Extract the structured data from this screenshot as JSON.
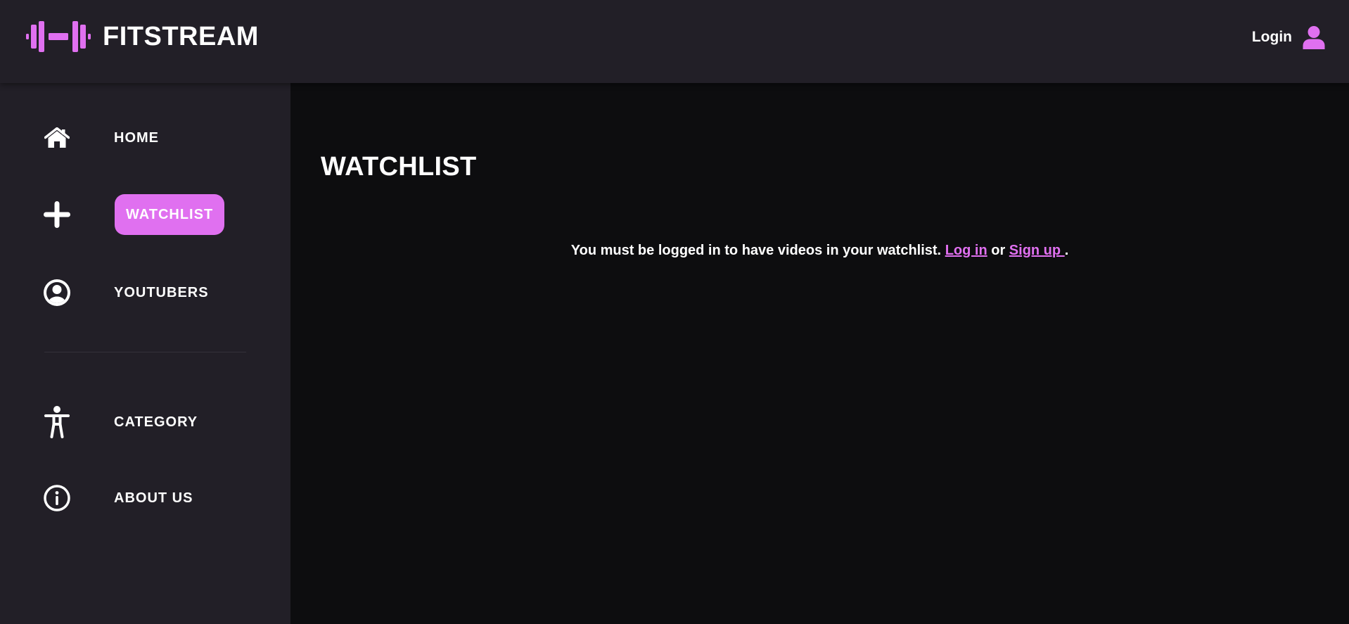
{
  "brand": {
    "name": "FITSTREAM",
    "logo_icon": "dumbbell-icon"
  },
  "header": {
    "login_label": "Login",
    "user_icon": "user-icon"
  },
  "sidebar": {
    "items": [
      {
        "label": "HOME",
        "icon": "home-icon"
      },
      {
        "label": "WATCHLIST",
        "icon": "plus-icon",
        "active": true
      },
      {
        "label": "YOUTUBERS",
        "icon": "user-circle-icon"
      },
      {
        "label": "CATEGORY",
        "icon": "accessibility-icon"
      },
      {
        "label": "ABOUT US",
        "icon": "info-icon"
      }
    ]
  },
  "main": {
    "title": "WATCHLIST",
    "message": {
      "prefix": "You must be logged in to have videos in your watchlist. ",
      "login_link": "Log in",
      "middle": " or ",
      "signup_link": "Sign up ",
      "suffix": "."
    }
  },
  "colors": {
    "accent": "#e070f0",
    "header_bg": "#221f27",
    "sidebar_bg": "#221f27",
    "main_bg": "#0d0d0f",
    "text": "#ffffff"
  }
}
